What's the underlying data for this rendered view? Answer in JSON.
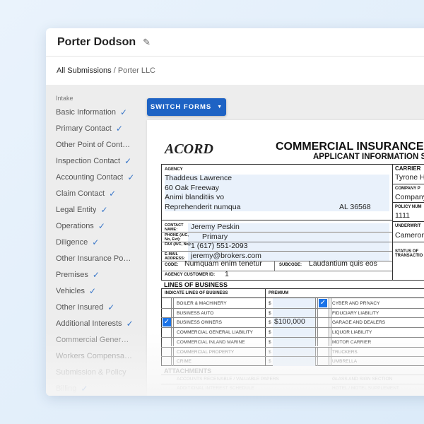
{
  "header": {
    "title": "Porter Dodson",
    "edit_icon": "pencil-icon"
  },
  "breadcrumb": {
    "root": "All Submissions",
    "separator": " / ",
    "current": "Porter LLC"
  },
  "sidebar": {
    "section": "Intake",
    "items": [
      {
        "label": "Basic Information",
        "done": true
      },
      {
        "label": "Primary Contact",
        "done": true
      },
      {
        "label": "Other Point of Contact",
        "done": false
      },
      {
        "label": "Inspection Contact",
        "done": true
      },
      {
        "label": "Accounting Contact",
        "done": true
      },
      {
        "label": "Claim Contact",
        "done": true
      },
      {
        "label": "Legal Entity",
        "done": true
      },
      {
        "label": "Operations",
        "done": true
      },
      {
        "label": "Diligence",
        "done": true
      },
      {
        "label": "Other Insurance Policies",
        "done": false
      },
      {
        "label": "Premises",
        "done": true
      },
      {
        "label": "Vehicles",
        "done": true
      },
      {
        "label": "Other Insured",
        "done": true
      },
      {
        "label": "Additional Interests",
        "done": true
      },
      {
        "label": "Commercial General Liability",
        "done": false
      },
      {
        "label": "Workers Compensation",
        "done": false
      },
      {
        "label": "Submission & Policy",
        "done": false
      },
      {
        "label": "Billing",
        "done": true
      }
    ]
  },
  "switch_forms": "SWITCH FORMS",
  "form": {
    "logo": "ACORD",
    "title": "COMMERCIAL INSURANCE A",
    "subtitle": "APPLICANT INFORMATION S",
    "agency_label": "AGENCY",
    "agency_lines": [
      "Thaddeus Lawrence",
      "60 Oak Freeway",
      "Animi blanditiis vo",
      "Reprehenderit numqua"
    ],
    "agency_state_zip": "AL   36568",
    "contact_label": "CONTACT NAME:",
    "contact": "Jeremy Peskin",
    "phone_label": "PHONE (A/C, No, Ext):",
    "phone": "Primary",
    "fax_label": "FAX (A/C, No):",
    "fax": "1 (617) 551-2093",
    "email_label": "E-MAIL ADDRESS:",
    "email": "jeremy@brokers.com",
    "code_label": "CODE:",
    "code": "Numquam enim tenetur",
    "subcode_label": "SUBCODE:",
    "subcode": "Laudantium quis eos",
    "customer_id_label": "AGENCY CUSTOMER ID:",
    "customer_id": "1",
    "carrier_label": "CARRIER",
    "carrier": "Tyrone H",
    "company_label": "COMPANY P",
    "company": "Company",
    "policy_label": "POLICY NUM",
    "policy": "1111",
    "underwriter_label": "UNDERWRIT",
    "underwriter": "Cameron",
    "status_label": "STATUS OF TRANSACTIO",
    "lob_heading": "LINES OF BUSINESS",
    "lob_col1": "INDICATE LINES OF BUSINESS",
    "lob_col2": "PREMIUM",
    "lob_left": [
      {
        "label": "BOILER & MACHINERY",
        "checked": false,
        "premium": ""
      },
      {
        "label": "BUSINESS AUTO",
        "checked": false,
        "premium": ""
      },
      {
        "label": "BUSINESS OWNERS",
        "checked": true,
        "premium": "$100,000"
      },
      {
        "label": "COMMERCIAL GENERAL LIABILITY",
        "checked": false,
        "premium": ""
      },
      {
        "label": "COMMERCIAL INLAND MARINE",
        "checked": false,
        "premium": ""
      },
      {
        "label": "COMMERCIAL PROPERTY",
        "checked": false,
        "premium": ""
      },
      {
        "label": "CRIME",
        "checked": false,
        "premium": ""
      }
    ],
    "lob_right": [
      {
        "label": "CYBER AND PRIVACY",
        "checked": true
      },
      {
        "label": "FIDUCIARY LIABILITY",
        "checked": false
      },
      {
        "label": "GARAGE AND DEALERS",
        "checked": false
      },
      {
        "label": "LIQUOR LIABILITY",
        "checked": false
      },
      {
        "label": "MOTOR CARRIER",
        "checked": false
      },
      {
        "label": "TRUCKERS",
        "checked": false
      },
      {
        "label": "UMBRELLA",
        "checked": false
      }
    ],
    "dollar": "$",
    "attachments_heading": "ATTACHMENTS",
    "attachments_left": [
      "ACCOUNTS RECEIVABLE / VALUABLE PAPERS",
      "ADDITIONAL INTEREST SCHEDULE"
    ],
    "attachments_right": [
      "GLASS AND SIGN SECTION",
      "HOTEL / MOTEL SUPPLEMENT"
    ]
  }
}
